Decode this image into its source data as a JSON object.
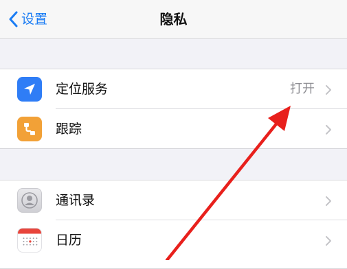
{
  "navbar": {
    "back_label": "设置",
    "title": "隐私"
  },
  "groups": [
    {
      "rows": [
        {
          "label": "定位服务",
          "value": "打开",
          "icon": "location-arrow-icon"
        },
        {
          "label": "跟踪",
          "value": "",
          "icon": "tracking-icon"
        }
      ]
    },
    {
      "rows": [
        {
          "label": "通讯录",
          "value": "",
          "icon": "contacts-icon"
        },
        {
          "label": "日历",
          "value": "",
          "icon": "calendar-icon"
        }
      ]
    }
  ],
  "annotation": {
    "arrow_color": "#e8201c"
  },
  "colors": {
    "accent": "#1a7cf4",
    "location_icon": "#2f7df6",
    "tracking_icon": "#f2a137"
  }
}
